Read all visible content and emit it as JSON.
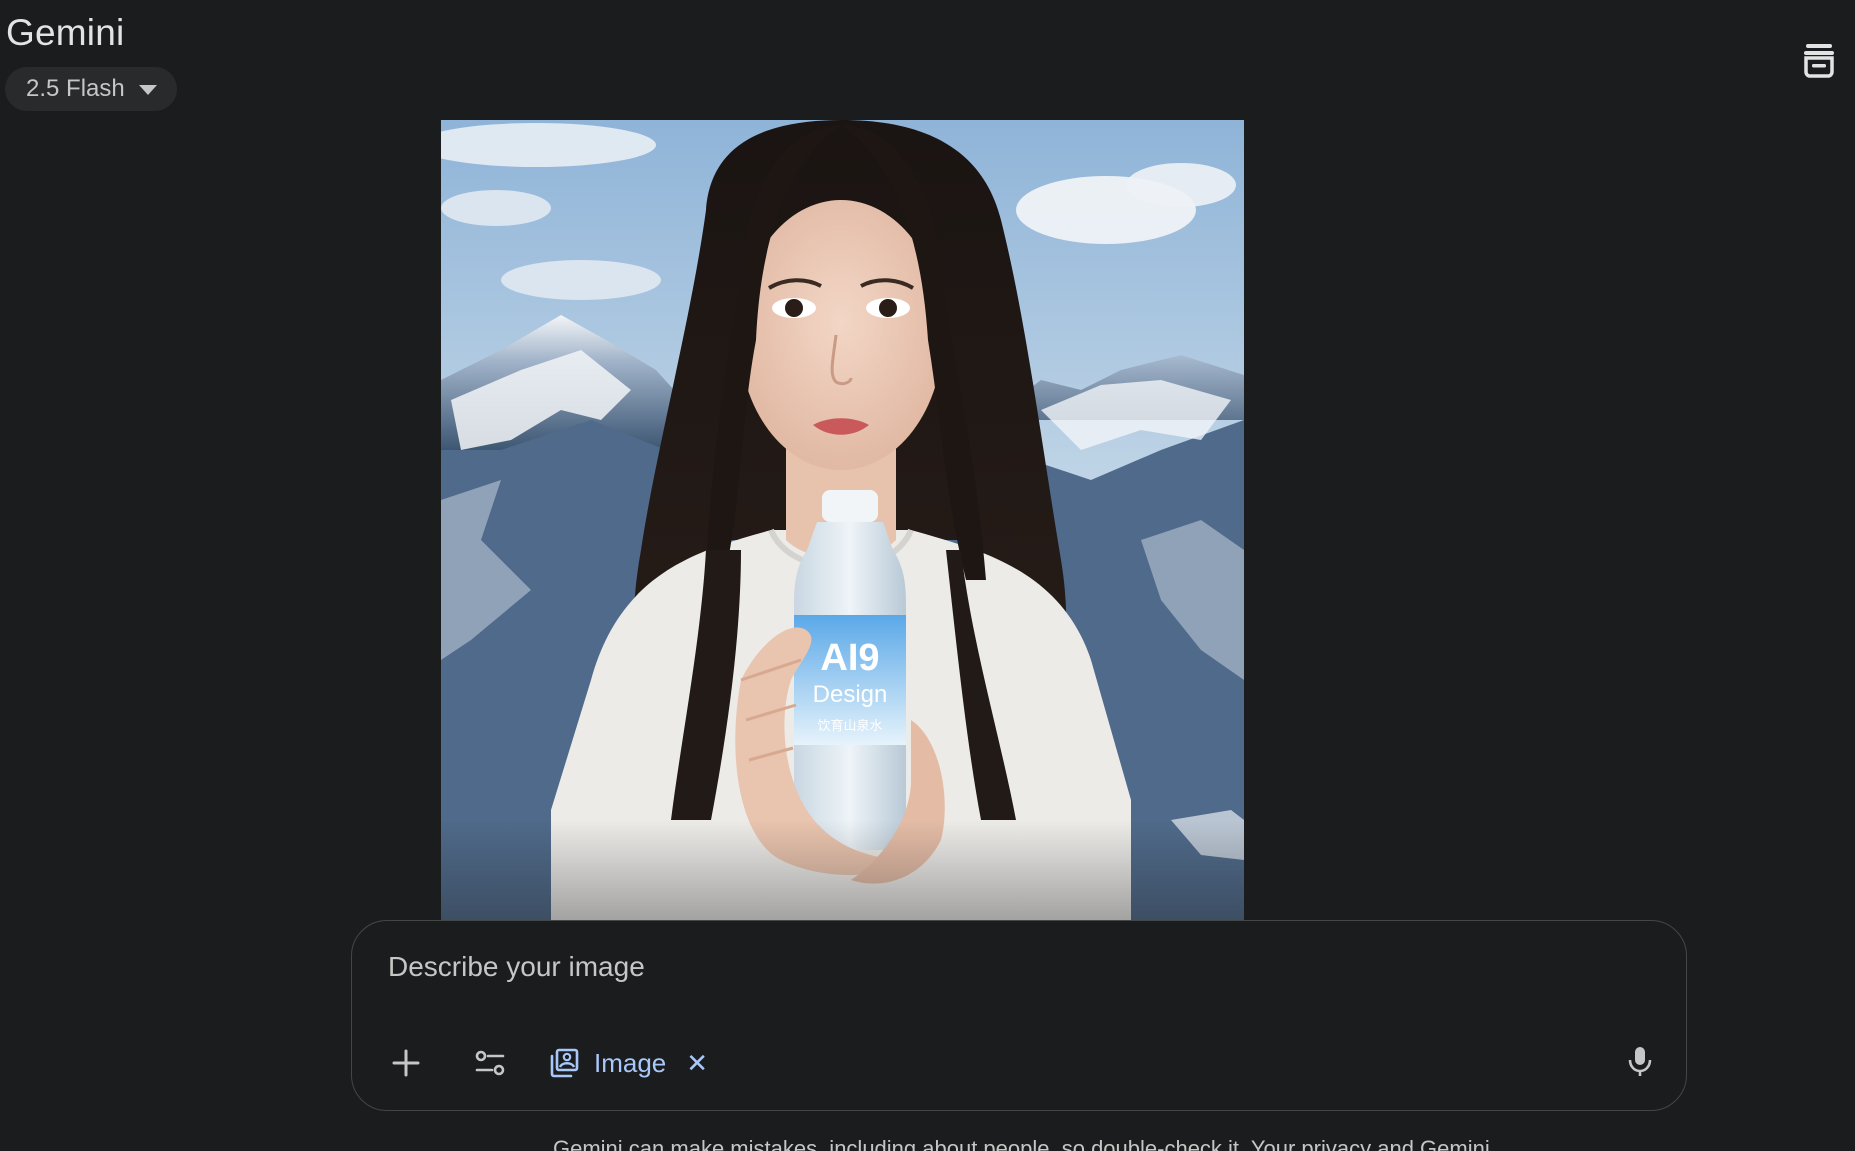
{
  "header": {
    "app_title": "Gemini",
    "model_label": "2.5 Flash",
    "model_caret_icon": "caret-down-icon",
    "temp_chat_icon": "temporary-chat-icon"
  },
  "image": {
    "description_visible_text": {
      "bottle_brand_line1": "AI9",
      "bottle_brand_line2": "Design",
      "bottle_brand_line3": "饮育山泉水"
    }
  },
  "composer": {
    "placeholder": "Describe your image",
    "add_icon": "plus-icon",
    "tools_icon": "tools-sliders-icon",
    "chip": {
      "icon": "image-stack-icon",
      "label": "Image",
      "close": "✕"
    },
    "mic_icon": "microphone-icon"
  },
  "footer": {
    "disclaimer": "Gemini can make mistakes, including about people, so double-check it. Your privacy and Gemini"
  },
  "colors": {
    "background": "#1b1c1d",
    "chip_blue": "#a8c7fa",
    "border": "#444746",
    "pill_bg": "#282a2c"
  }
}
